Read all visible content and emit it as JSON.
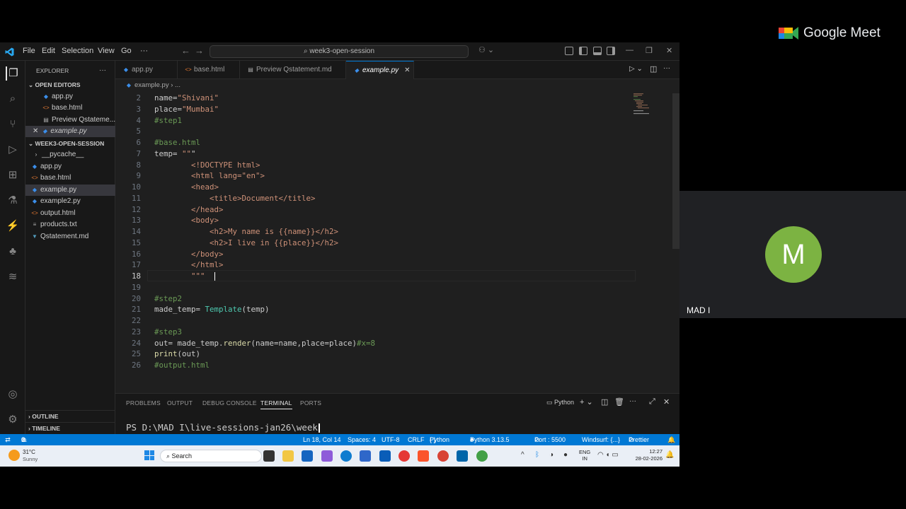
{
  "meet": {
    "brand": "Google Meet",
    "participant_initial": "M",
    "participant_name": "MAD I"
  },
  "titlebar": {
    "menus": [
      "File",
      "Edit",
      "Selection",
      "View",
      "Go",
      "···"
    ],
    "search": "week3-open-session"
  },
  "sidebar": {
    "header": "EXPLORER",
    "more": "···",
    "open_editors_label": "OPEN EDITORS",
    "open_editors": [
      {
        "name": "app.py",
        "icon": "python-file-icon"
      },
      {
        "name": "base.html",
        "icon": "html-file-icon"
      },
      {
        "name": "Preview Qstateme...",
        "icon": "preview-icon"
      },
      {
        "name": "example.py",
        "icon": "python-file-icon"
      }
    ],
    "folder_label": "WEEK3-OPEN-SESSION",
    "files": [
      {
        "name": "__pycache__",
        "icon": "folder-icon"
      },
      {
        "name": "app.py",
        "icon": "python-file-icon"
      },
      {
        "name": "base.html",
        "icon": "html-file-icon"
      },
      {
        "name": "example.py",
        "icon": "python-file-icon"
      },
      {
        "name": "example2.py",
        "icon": "python-file-icon"
      },
      {
        "name": "output.html",
        "icon": "html-file-icon"
      },
      {
        "name": "products.txt",
        "icon": "text-file-icon"
      },
      {
        "name": "Qstatement.md",
        "icon": "markdown-file-icon"
      }
    ],
    "outline_label": "OUTLINE",
    "timeline_label": "TIMELINE"
  },
  "tabs": [
    "app.py",
    "base.html",
    "Preview Qstatement.md",
    "example.py"
  ],
  "breadcrumb": {
    "file": "example.py",
    "rest": "..."
  },
  "editor": {
    "lines": [
      {
        "n": "2",
        "t": "name=\"Shivani\""
      },
      {
        "n": "3",
        "t": "place=\"Mumbai\""
      },
      {
        "n": "4",
        "t": "#step1"
      },
      {
        "n": "5",
        "t": ""
      },
      {
        "n": "6",
        "t": "#base.html"
      },
      {
        "n": "7",
        "t": "temp= \"\"\""
      },
      {
        "n": "8",
        "t": "        <!DOCTYPE html>"
      },
      {
        "n": "9",
        "t": "        <html lang=\"en\">"
      },
      {
        "n": "10",
        "t": "        <head>"
      },
      {
        "n": "11",
        "t": "            <title>Document</title>"
      },
      {
        "n": "12",
        "t": "        </head>"
      },
      {
        "n": "13",
        "t": "        <body>"
      },
      {
        "n": "14",
        "t": "            <h2>My name is {{name}}</h2>"
      },
      {
        "n": "15",
        "t": "            <h2>I live in {{place}}</h2>"
      },
      {
        "n": "16",
        "t": "        </body>"
      },
      {
        "n": "17",
        "t": "        </html>"
      },
      {
        "n": "18",
        "t": "        \"\"\"  "
      },
      {
        "n": "19",
        "t": ""
      },
      {
        "n": "20",
        "t": "#step2"
      },
      {
        "n": "21",
        "t": "made_temp= Template(temp)"
      },
      {
        "n": "22",
        "t": ""
      },
      {
        "n": "23",
        "t": "#step3"
      },
      {
        "n": "24",
        "t": "out= made_temp.render(name=name,place=place)#x=8"
      },
      {
        "n": "25",
        "t": "print(out)"
      },
      {
        "n": "26",
        "t": "#output.html"
      }
    ]
  },
  "panel": {
    "tabs": [
      "PROBLEMS",
      "OUTPUT",
      "DEBUG CONSOLE",
      "TERMINAL",
      "PORTS"
    ],
    "shell": "Python",
    "terminal_text": "PS D:\\MAD I\\live-sessions-jan26\\week"
  },
  "status": {
    "errors": "0",
    "warnings": "0",
    "position": "Ln 18, Col 14",
    "spaces": "Spaces: 4",
    "encoding": "UTF-8",
    "eol": "CRLF",
    "lang": "Python",
    "interpreter": "Python 3.13.5",
    "port": "Port : 5500",
    "windsurf": "Windsurf: {...}",
    "prettier": "Prettier"
  },
  "taskbar": {
    "temp": "31°C",
    "weather": "Sunny",
    "search": "Search",
    "lang1": "ENG",
    "lang2": "IN",
    "time": "12:27",
    "date": "28-02-2026"
  },
  "colors": {
    "accent": "#0078d4",
    "statusbar": "#0078d4",
    "avatar": "#7cb342"
  }
}
